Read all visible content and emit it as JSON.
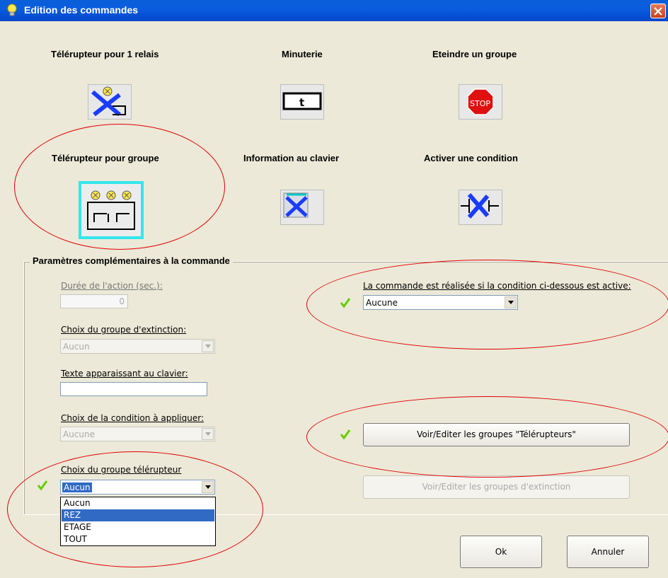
{
  "window": {
    "title": "Edition des commandes"
  },
  "commands": [
    {
      "label": "Télérupteur pour 1 relais"
    },
    {
      "label": "Minuterie",
      "icon_text": "t"
    },
    {
      "label": "Eteindre un groupe",
      "icon_text": "STOP"
    },
    {
      "label": "Télérupteur pour groupe"
    },
    {
      "label": "Information au clavier"
    },
    {
      "label": "Activer une condition"
    }
  ],
  "params": {
    "title": "Paramètres complémentaires à la commande",
    "duration_label": "Durée de l'action (sec.):",
    "duration_value": "0",
    "extinction_label": "Choix du groupe d'extinction:",
    "extinction_value": "Aucun",
    "keyboard_text_label": "Texte apparaissant au clavier:",
    "keyboard_text_value": "",
    "condition_label": "Choix de la condition à appliquer:",
    "condition_value": "Aucune",
    "telerupteur_label": "Choix du groupe télérupteur",
    "telerupteur_value": "Aucun",
    "telerupteur_options": [
      "Aucun",
      "REZ",
      "ETAGE",
      "TOUT"
    ],
    "telerupteur_hover_index": 1,
    "active_condition_label": "La commande est réalisée si la condition ci-dessous est active:",
    "active_condition_value": "Aucune",
    "view_telerupteurs_button": "Voir/Editer les groupes \"Télérupteurs\"",
    "view_extinction_button": "Voir/Editer les groupes d'extinction"
  },
  "buttons": {
    "ok": "Ok",
    "cancel": "Annuler"
  },
  "colors": {
    "annotation": "#e00000",
    "selection": "#33e6ee",
    "highlight": "#316ac5",
    "check": "#66cc00"
  }
}
